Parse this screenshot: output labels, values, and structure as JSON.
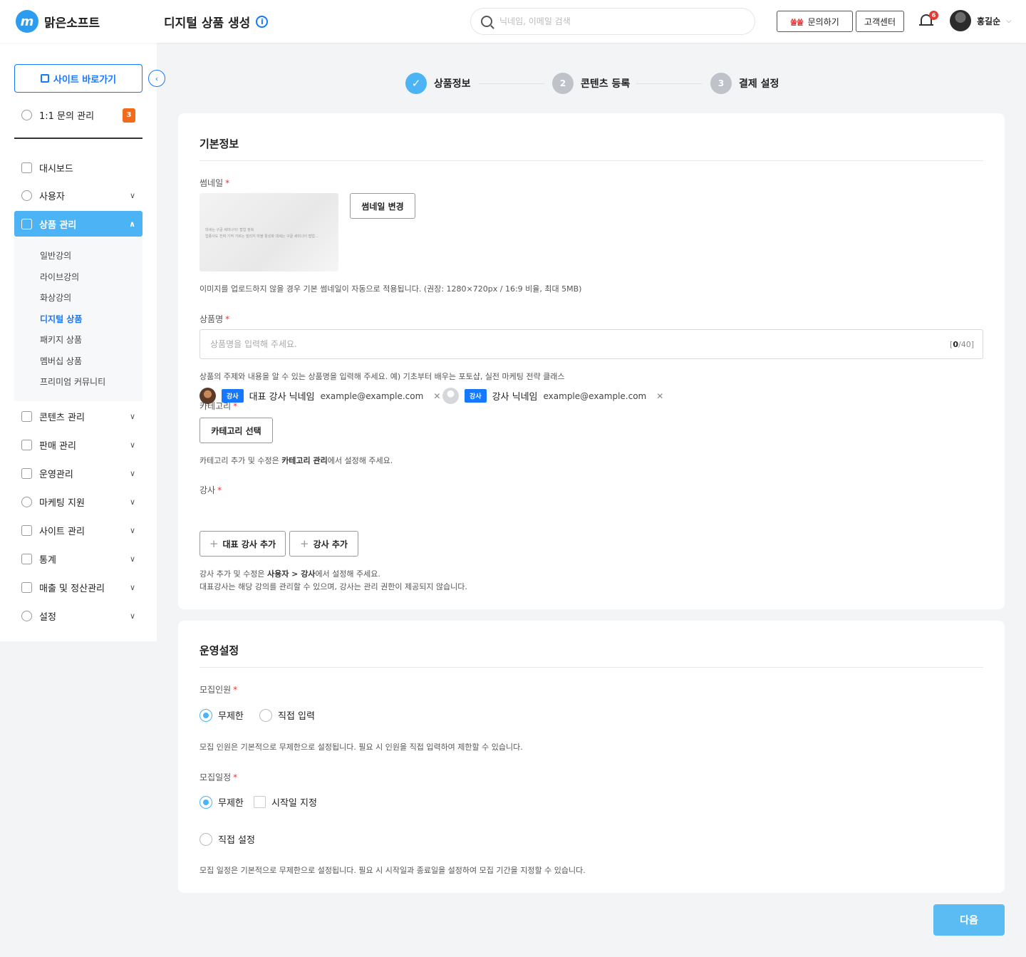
{
  "header": {
    "brand": "맑은소프트",
    "page_title": "디지털 상품 생성",
    "search_placeholder": "닉네임, 이메일 검색",
    "ssam_label": "쏠쏠",
    "inquiry_button": "문의하기",
    "support_button": "고객센터",
    "notification_count": "6",
    "user_name": "홍길순"
  },
  "sidebar": {
    "site_button": "사이트 바로가기",
    "inquiry": {
      "label": "1:1 문의 관리",
      "badge": "3"
    },
    "menu": [
      {
        "label": "대시보드",
        "icon": "dashboard-icon"
      },
      {
        "label": "사용자",
        "icon": "user-icon"
      },
      {
        "label": "상품 관리",
        "icon": "product-icon",
        "active": true
      },
      {
        "label": "콘텐츠 관리",
        "icon": "content-icon"
      },
      {
        "label": "판매 관리",
        "icon": "sales-icon"
      },
      {
        "label": "운영관리",
        "icon": "operation-icon"
      },
      {
        "label": "마케팅 지원",
        "icon": "marketing-icon"
      },
      {
        "label": "사이트 관리",
        "icon": "site-icon"
      },
      {
        "label": "통계",
        "icon": "stats-icon"
      },
      {
        "label": "매출 및 정산관리",
        "icon": "cart-icon"
      },
      {
        "label": "설정",
        "icon": "settings-icon"
      }
    ],
    "submenu": [
      {
        "label": "일반강의"
      },
      {
        "label": "라이브강의"
      },
      {
        "label": "화상강의"
      },
      {
        "label": "디지털 상품",
        "active": true
      },
      {
        "label": "패키지 상품"
      },
      {
        "label": "멤버십 상품"
      },
      {
        "label": "프리미엄 커뮤니티"
      }
    ]
  },
  "steps": [
    {
      "number": "✓",
      "label": "상품정보",
      "status": "done"
    },
    {
      "number": "2",
      "label": "콘텐츠 등록",
      "status": "todo"
    },
    {
      "number": "3",
      "label": "결제 설정",
      "status": "todo"
    }
  ],
  "basic": {
    "title": "기본정보",
    "thumbnail_label": "썸네일",
    "thumbnail_text_1": "대세는 구글 세미나이! 팝업 정복",
    "thumbnail_text_2": "업종사도 진짜 기적 가르는 빌리지 마블 활성화 대세는 구글 세미나이 팝업…",
    "thumbnail_button": "썸네일 변경",
    "thumbnail_help": "이미지를 업로드하지 않을 경우 기본 썸네일이 자동으로 적용됩니다. (권장: 1280×720px / 16:9 비율, 최대 5MB)",
    "name_label": "상품명",
    "name_placeholder": "상품명을 입력해 주세요.",
    "name_count": "0",
    "name_max": "/40]",
    "name_open": "[",
    "name_help": "상품의 주제와 내용을 알 수 있는 상품명을 입력해 주세요. 예) 기초부터 배우는 포토샵, 실전 마케팅 전략 클래스",
    "category_label": "카테고리",
    "category_button": "카테고리 선택",
    "category_help_pre": "카테고리 추가 및 수정은 ",
    "category_help_bold": "카테고리 관리",
    "category_help_post": "에서 설정해 주세요.",
    "instructor_label": "강사",
    "instructors": [
      {
        "tag": "강사",
        "name": "대표 강사 닉네임",
        "email": "example@example.com"
      },
      {
        "tag": "강사",
        "name": "강사 닉네임",
        "email": "example@example.com"
      }
    ],
    "add_lead_button": "대표 강사 추가",
    "add_instructor_button": "강사 추가",
    "instructor_help_pre": "강사 추가 및 수정은 ",
    "instructor_help_bold": "사용자 > 강사",
    "instructor_help_post": "에서 설정해 주세요.",
    "instructor_help_2": "대표강사는 해당 강의를 관리할 수 있으며, 강사는 관리 권한이 제공되지 않습니다."
  },
  "operation": {
    "title": "운영설정",
    "recruit_label": "모집인원",
    "recruit_options": [
      "무제한",
      "직접 입력"
    ],
    "recruit_help": "모집 인원은 기본적으로 무제한으로 설정됩니다. 필요 시 인원을 직접 입력하여 제한할 수 있습니다.",
    "schedule_label": "모집일정",
    "schedule_unlimited": "무제한",
    "schedule_start": "시작일 지정",
    "schedule_custom": "직접 설정",
    "schedule_help": "모집 일정은 기본적으로 무제한으로 설정됩니다. 필요 시 시작일과 종료일을 설정하여 모집 기간을 지정할 수 있습니다."
  },
  "next_button": "다음",
  "colors": {
    "accent": "#1677ff",
    "primary_light": "#4cb3f5",
    "badge": "#f26a1b"
  }
}
